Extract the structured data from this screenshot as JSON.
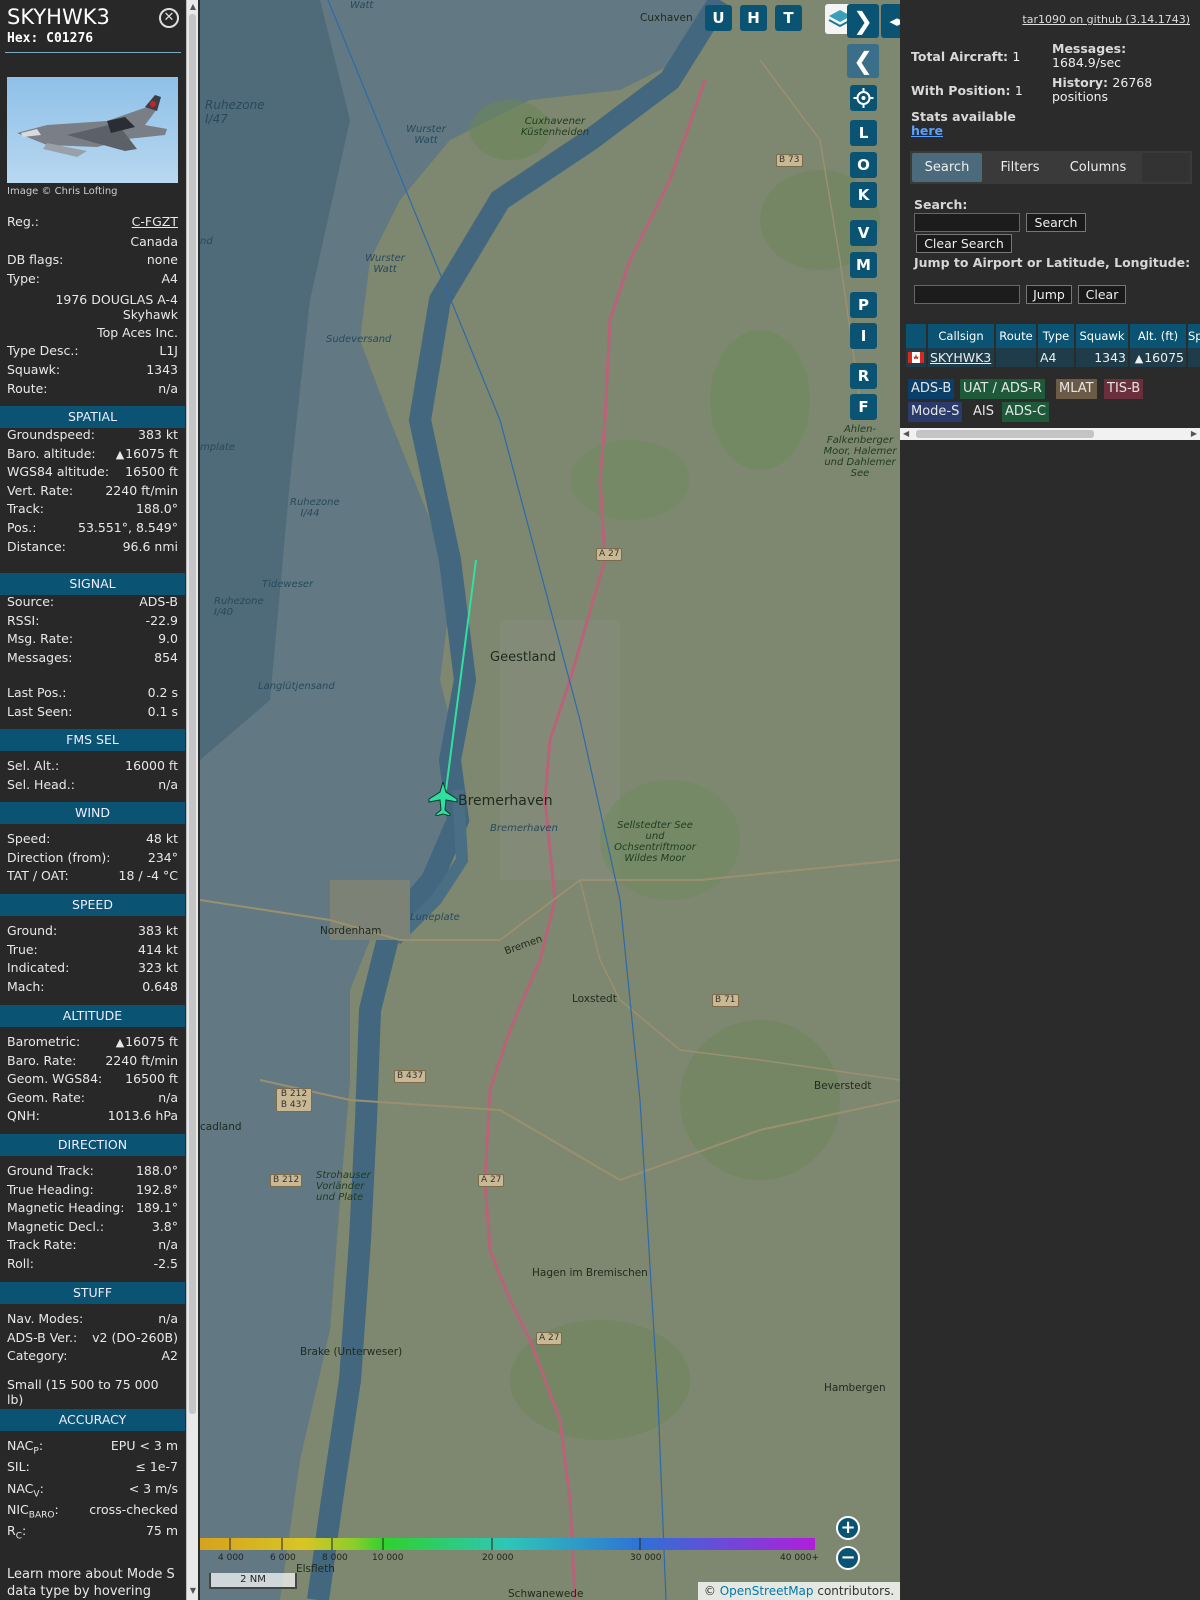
{
  "aircraft": {
    "callsign": "SKYHWK3",
    "hex_label": "Hex:",
    "hex": "C01276",
    "close_icon": "✕",
    "image_credit": "Image © Chris Lofting",
    "reg_label": "Reg.:",
    "reg": "C-FGZT",
    "country": "Canada",
    "db_flags_label": "DB flags:",
    "db_flags": "none",
    "type_label": "Type:",
    "type": "A4",
    "type_full": "1976 DOUGLAS A-4 Skyhawk",
    "operator": "Top Aces Inc.",
    "type_desc_label": "Type Desc.:",
    "type_desc": "L1J",
    "squawk_label": "Squawk:",
    "squawk": "1343",
    "route_label": "Route:",
    "route": "n/a"
  },
  "sections": {
    "spatial": "SPATIAL",
    "signal": "SIGNAL",
    "fms": "FMS SEL",
    "wind": "WIND",
    "speed": "SPEED",
    "altitude": "ALTITUDE",
    "direction": "DIRECTION",
    "stuff": "STUFF",
    "accuracy": "ACCURACY"
  },
  "spatial": [
    {
      "label": "Groundspeed:",
      "value": "383 kt"
    },
    {
      "label": "Baro. altitude:",
      "value": "16075 ft",
      "tri": true
    },
    {
      "label": "WGS84 altitude:",
      "value": "16500 ft"
    },
    {
      "label": "Vert. Rate:",
      "value": "2240 ft/min"
    },
    {
      "label": "Track:",
      "value": "188.0°"
    },
    {
      "label": "Pos.:",
      "value": "53.551°, 8.549°"
    },
    {
      "label": "Distance:",
      "value": "96.6 nmi"
    }
  ],
  "signal": [
    {
      "label": "Source:",
      "value": "ADS-B"
    },
    {
      "label": "RSSI:",
      "value": "-22.9"
    },
    {
      "label": "Msg. Rate:",
      "value": "9.0"
    },
    {
      "label": "Messages:",
      "value": "854"
    },
    {
      "label": "Last Pos.:",
      "value": "0.2 s"
    },
    {
      "label": "Last Seen:",
      "value": "0.1 s"
    }
  ],
  "fms": [
    {
      "label": "Sel. Alt.:",
      "value": "16000 ft"
    },
    {
      "label": "Sel. Head.:",
      "value": "n/a"
    }
  ],
  "wind": [
    {
      "label": "Speed:",
      "value": "48 kt"
    },
    {
      "label": "Direction (from):",
      "value": "234°"
    },
    {
      "label": "TAT / OAT:",
      "value": "18 / -4 °C"
    }
  ],
  "speed": [
    {
      "label": "Ground:",
      "value": "383 kt"
    },
    {
      "label": "True:",
      "value": "414 kt"
    },
    {
      "label": "Indicated:",
      "value": "323 kt"
    },
    {
      "label": "Mach:",
      "value": "0.648"
    }
  ],
  "altitude": [
    {
      "label": "Barometric:",
      "value": "16075 ft",
      "tri": true
    },
    {
      "label": "Baro. Rate:",
      "value": "2240 ft/min"
    },
    {
      "label": "Geom. WGS84:",
      "value": "16500 ft"
    },
    {
      "label": "Geom. Rate:",
      "value": "n/a"
    },
    {
      "label": "QNH:",
      "value": "1013.6 hPa"
    }
  ],
  "direction": [
    {
      "label": "Ground Track:",
      "value": "188.0°"
    },
    {
      "label": "True Heading:",
      "value": "192.8°"
    },
    {
      "label": "Magnetic Heading:",
      "value": "189.1°"
    },
    {
      "label": "Magnetic Decl.:",
      "value": "3.8°"
    },
    {
      "label": "Track Rate:",
      "value": "n/a"
    },
    {
      "label": "Roll:",
      "value": "-2.5"
    }
  ],
  "stuff": [
    {
      "label": "Nav. Modes:",
      "value": "n/a"
    },
    {
      "label": "ADS-B Ver.:",
      "value": "v2 (DO-260B)"
    },
    {
      "label": "Category:",
      "value": "A2"
    }
  ],
  "stuff_category_desc": "Small (15 500 to 75 000 lb)",
  "accuracy": [
    {
      "label": "NAC",
      "sub": "P",
      "suffix": ":",
      "value": "EPU < 3 m"
    },
    {
      "label": "SIL:",
      "sub": "",
      "suffix": "",
      "value": "≤ 1e-7"
    },
    {
      "label": "NAC",
      "sub": "V",
      "suffix": ":",
      "value": "< 3 m/s"
    },
    {
      "label": "NIC",
      "sub": "BARO",
      "suffix": ":",
      "value": "cross-checked"
    },
    {
      "label": "R",
      "sub": "C",
      "suffix": ":",
      "value": "75 m"
    }
  ],
  "learn_more": "Learn more about Mode S data type by hovering over",
  "map": {
    "buttons": [
      "U",
      "H",
      "T"
    ],
    "side_buttons": [
      "L",
      "O",
      "K",
      "V",
      "M",
      "P",
      "I",
      "R",
      "F"
    ],
    "forward_icon": "❯",
    "back_icon": "❮",
    "expand_icon": "◂▸",
    "zoom_in": "+",
    "zoom_out": "−",
    "scale": "2 NM",
    "altitude_legend": [
      "4 000",
      "6 000",
      "8 000",
      "10 000",
      "20 000",
      "30 000",
      "40 000+"
    ],
    "attribution_prefix": "© ",
    "attribution_link": "OpenStreetMap",
    "attribution_suffix": " contributors.",
    "places": {
      "cuxhaven": "Cuxhaven",
      "geestland": "Geestland",
      "bremerhaven": "Bremerhaven",
      "bremerhaven_small": "Bremerhaven",
      "nordenham": "Nordenham",
      "loxstedt": "Loxstedt",
      "beverstedt": "Beverstedt",
      "hagen": "Hagen im Bremischen",
      "brake": "Brake (Unterweser)",
      "hambergen": "Hambergen",
      "elsfleth": "Elsfleth",
      "schwanewede": "Schwanewede",
      "stadland": "cadland",
      "watt": "Watt",
      "ruhezone147": "Ruhezone I/47",
      "wurster_watt": "Wurster Watt",
      "cuxhavener": "Cuxhavener Küstenheiden",
      "wurster_watt2": "Wurster Watt",
      "sudeversand": "Sudeversand",
      "ruhezone144": "Ruhezone I/44",
      "tideweser": "Tideweser",
      "ruhezone140": "Ruhezone I/40",
      "langlutjensand": "Langlütjensand",
      "luneplate": "Luneplate",
      "sellstedter": "Sellstedter See und Ochsentriftmoor Wildes Moor",
      "ahlen": "Ahlen-Falkenberger Moor, Halemer und Dahlemer See",
      "strohauser": "Strohauser Vorländer und Plate",
      "and_left": "nd",
      "mplate": "mplate",
      "bremen_road": "Bremen"
    },
    "shields": {
      "b73": "B 73",
      "a27_top": "A 27",
      "b71": "B 71",
      "b437": "B 437",
      "b212_437": "B 212 B 437",
      "b212": "B 212",
      "a27_mid": "A 27",
      "a27_low": "A 27"
    }
  },
  "right": {
    "version": "tar1090 on github (3.14.1743)",
    "total_label": "Total Aircraft:",
    "total": "1",
    "with_pos_label": "With Position:",
    "with_pos": "1",
    "messages_label": "Messages:",
    "messages": "1684.9/sec",
    "history_label": "History:",
    "history": "26768 positions",
    "stats_label": "Stats available",
    "stats_link": "here",
    "tabs": [
      "Search",
      "Filters",
      "Columns"
    ],
    "search_label": "Search:",
    "search_button": "Search",
    "clear_search_button": "Clear Search",
    "jump_label": "Jump to Airport or Latitude, Longitude:",
    "jump_button": "Jump",
    "clear_button": "Clear",
    "columns": [
      "Callsign",
      "Route",
      "Type",
      "Squawk",
      "Alt. (ft)",
      "Sp"
    ],
    "row": {
      "flag": "canada-flag-icon",
      "callsign": "SKYHWK3",
      "route": "",
      "type": "A4",
      "squawk": "1343",
      "alt": "16075"
    },
    "badges": [
      "ADS-B",
      "UAT / ADS-R",
      "MLAT",
      "TIS-B",
      "Mode-S",
      "AIS",
      "ADS-C"
    ]
  },
  "colors": {
    "accent": "#0a5373",
    "track": "#2fe0a0",
    "adsb": "#0a3f6a",
    "uat": "#1e5a3a",
    "mlat": "#6b5a45",
    "tisb": "#6a2f3a",
    "modes": "#2a3a6a",
    "adsc": "#1e5a3a"
  }
}
